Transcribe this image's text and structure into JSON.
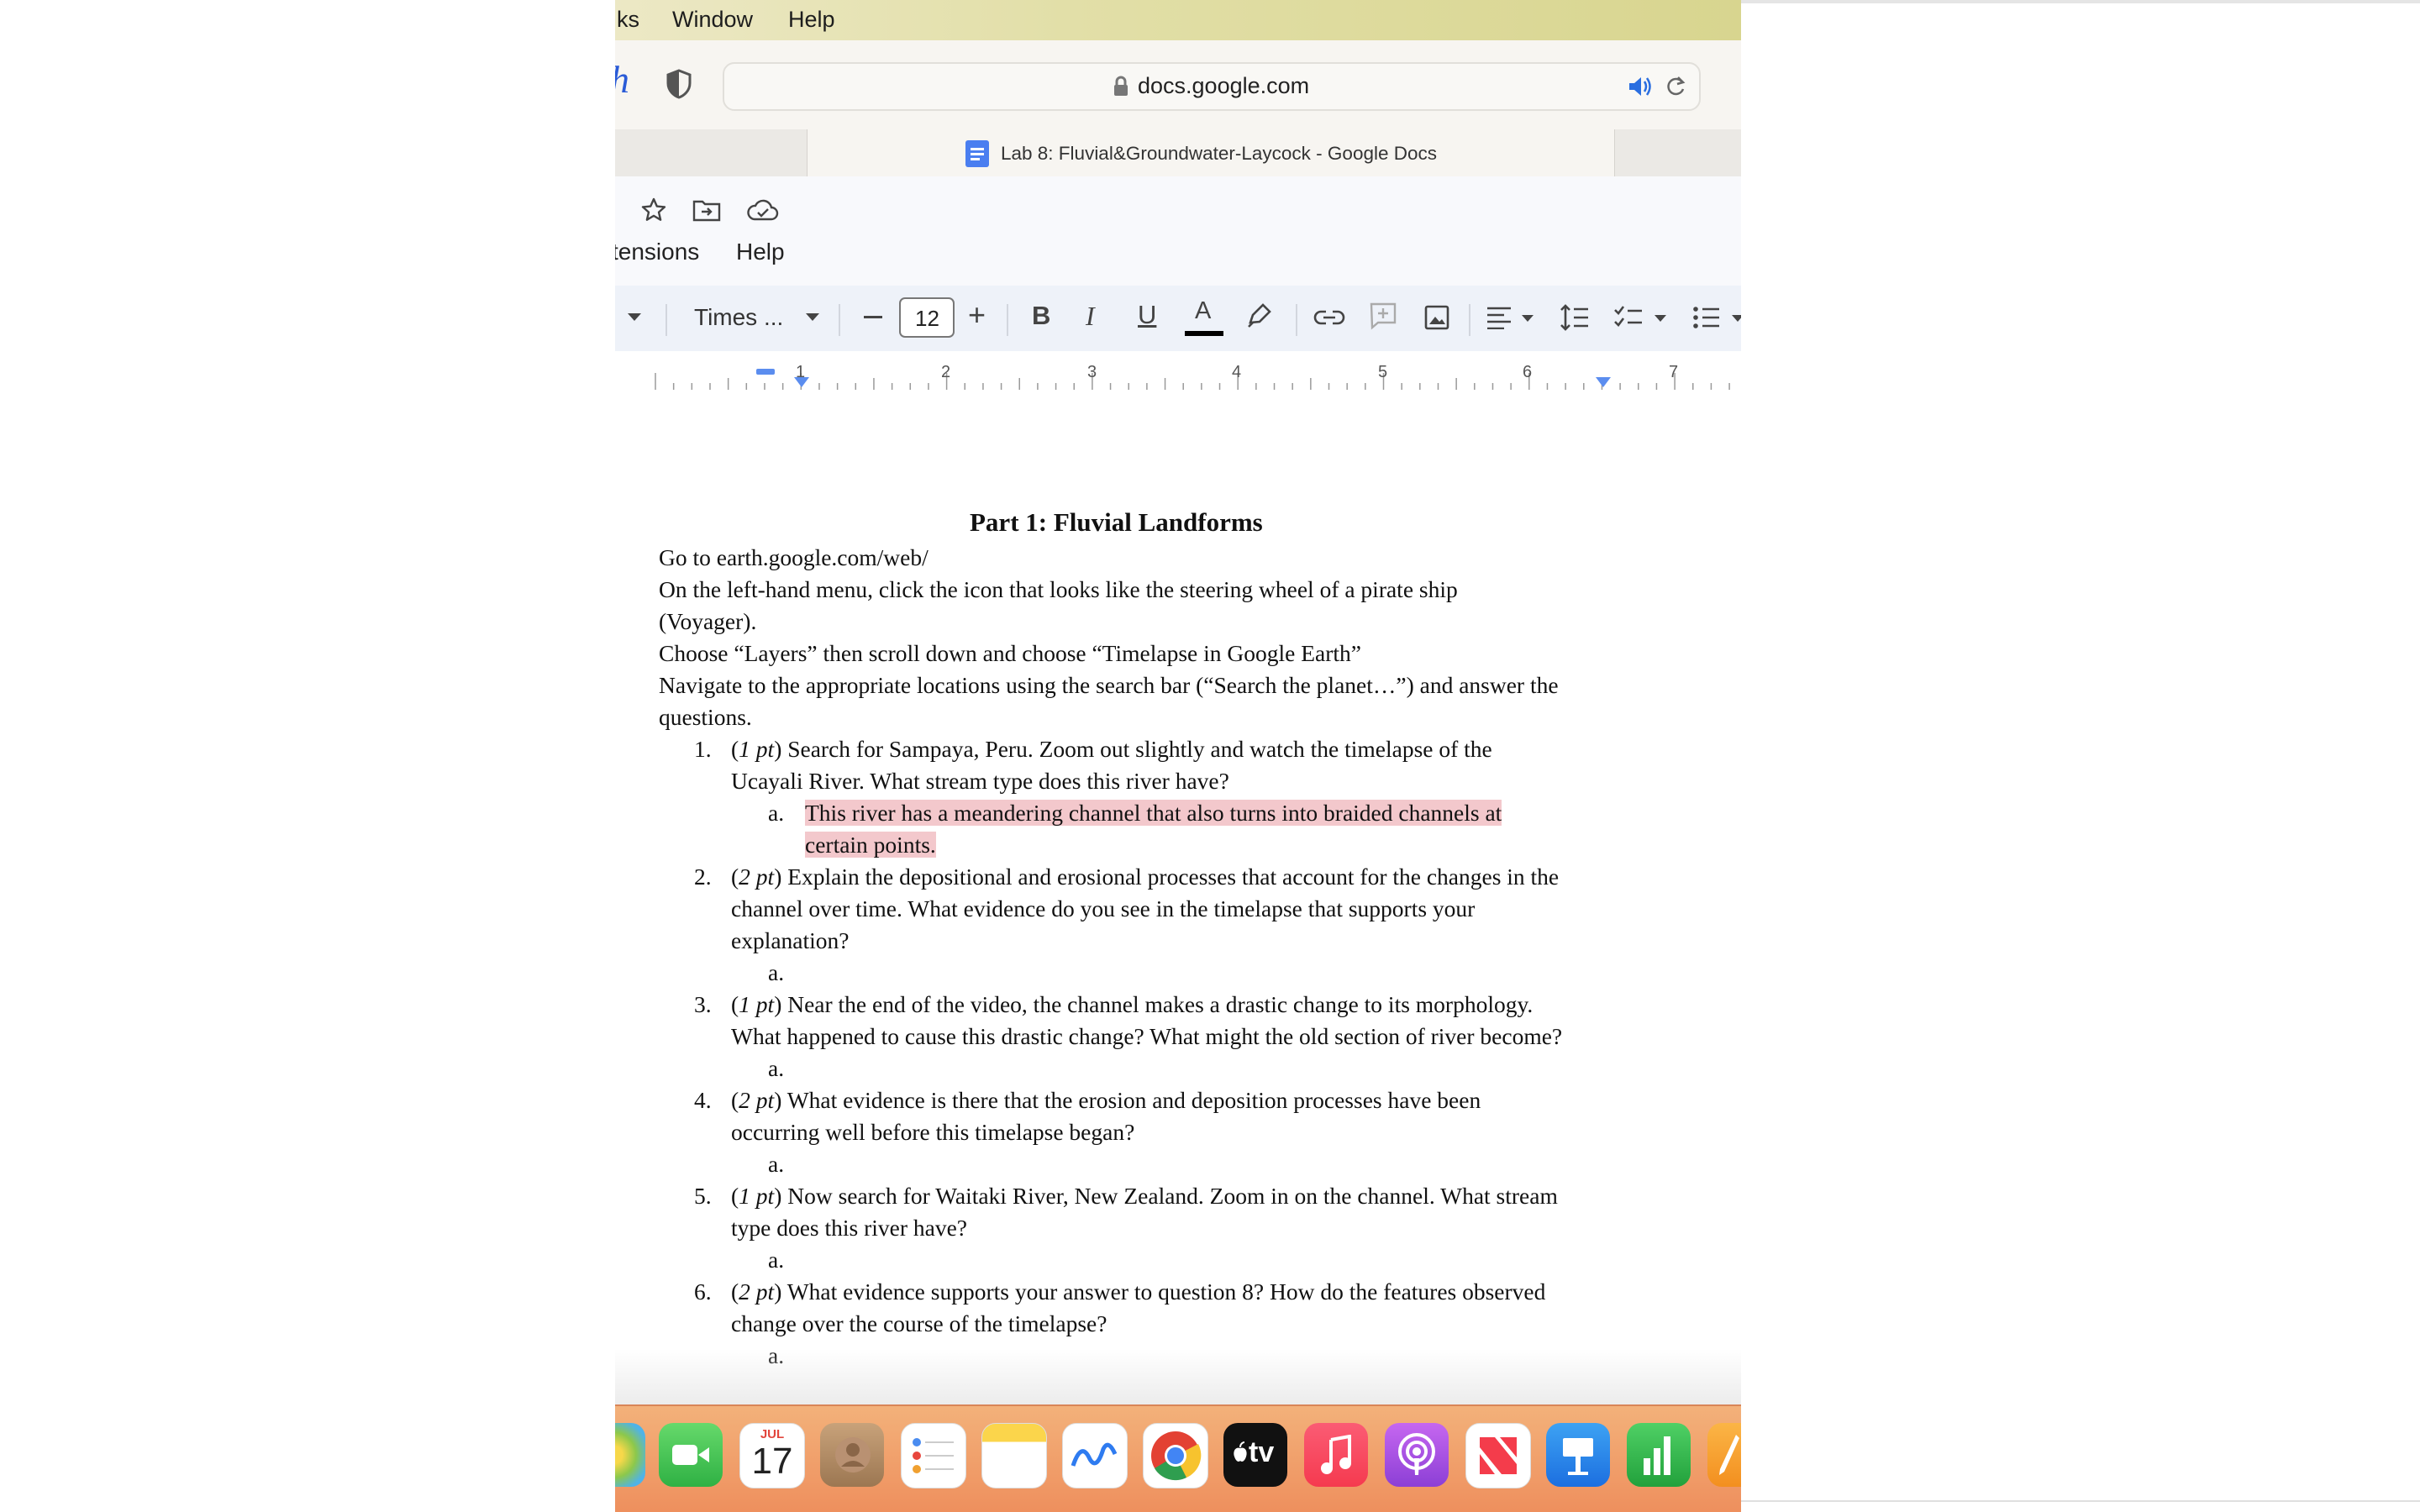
{
  "menubar": {
    "items": [
      "ks",
      "Window",
      "Help"
    ]
  },
  "browser": {
    "url": "docs.google.com",
    "tab_title": "Lab 8: Fluvial&Groundwater-Laycock - Google Docs"
  },
  "docs": {
    "menu": {
      "extensions": "tensions",
      "help": "Help"
    },
    "toolbar": {
      "font": "Times ...",
      "font_size": "12",
      "minus": "—",
      "plus": "+",
      "bold": "B",
      "italic": "I",
      "underline": "U",
      "text_color": "A"
    },
    "ruler": {
      "labels": [
        "1",
        "2",
        "3",
        "4",
        "5",
        "6",
        "7"
      ]
    }
  },
  "document": {
    "title": "Part 1: Fluvial Landforms",
    "intro": [
      "Go to earth.google.com/web/",
      "On the left-hand menu, click the icon that looks like the steering wheel of a pirate ship",
      "(Voyager).",
      "Choose “Layers” then scroll down and choose “Timelapse in Google Earth”",
      "Navigate to the appropriate locations using the search bar (“Search the planet…”) and answer the",
      "questions."
    ],
    "questions": [
      {
        "num": "1.",
        "pts": "1 pt",
        "lines": [
          ") Search for Sampaya, Peru. Zoom out slightly and watch the timelapse of the",
          "Ucayali River. What stream type does this river have?"
        ],
        "answer": [
          "This river has a meandering channel that also turns into braided channels at",
          "certain points."
        ]
      },
      {
        "num": "2.",
        "pts": "2 pt",
        "lines": [
          ") Explain the depositional and erosional processes that account for the changes in the",
          "channel over time. What evidence do you see in the timelapse that supports your",
          "explanation?"
        ],
        "answer": []
      },
      {
        "num": "3.",
        "pts": "1 pt",
        "lines": [
          ") Near the end of the video, the channel makes a drastic change to its morphology.",
          "What happened to cause this drastic change? What might the old section of river become?"
        ],
        "answer": []
      },
      {
        "num": "4.",
        "pts": "2 pt",
        "lines": [
          ") What evidence is there that the erosion and deposition processes have been",
          "occurring well before this timelapse began?"
        ],
        "answer": []
      },
      {
        "num": "5.",
        "pts": "1 pt",
        "lines": [
          ") Now search for Waitaki River, New Zealand. Zoom in on the channel. What stream",
          "type does this river have?"
        ],
        "answer": []
      },
      {
        "num": "6.",
        "pts": "2 pt",
        "lines": [
          ") What evidence supports your answer to question 8? How do the features observed",
          "change over the course of the timelapse?"
        ],
        "answer": []
      }
    ],
    "answer_marker": "a.",
    "open_paren": "("
  },
  "dock": {
    "calendar_month": "JUL",
    "calendar_day": "17",
    "tv_label": "tv",
    "icons": [
      "photos-icon",
      "facetime-icon",
      "calendar-icon",
      "contacts-icon",
      "reminders-icon",
      "notes-icon",
      "freeform-icon",
      "chrome-icon",
      "apple-tv-icon",
      "music-icon",
      "podcasts-icon",
      "news-icon",
      "keynote-icon",
      "numbers-icon",
      "pages-icon"
    ]
  }
}
